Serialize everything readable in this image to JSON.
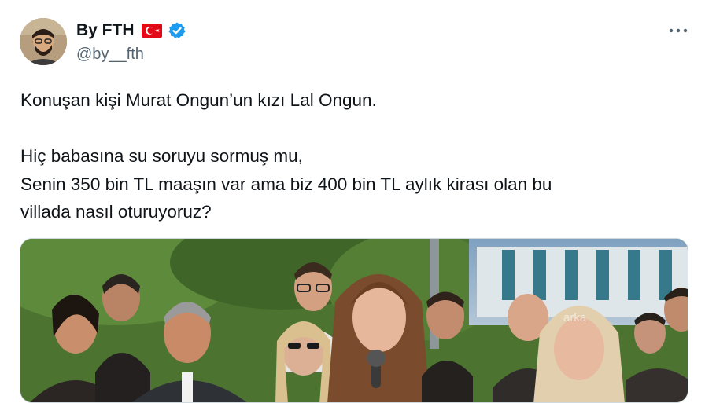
{
  "author": {
    "display_name": "By FTH",
    "handle": "@by__fth",
    "flag_icon": "turkey-flag-icon",
    "verified_icon": "verified-badge-icon"
  },
  "tweet": {
    "text": "Konuşan kişi Murat Ongun’un kızı Lal Ongun.\n\nHiç babasına su soruyu sormuş mu,\nSenin 350 bin TL maaşın var ama biz 400 bin TL aylık kirası olan bu\nvillada nasıl oturuyoruz?"
  },
  "media": {
    "watermark": "arka"
  },
  "colors": {
    "verified": "#1d9bf0",
    "flag_red": "#e30a17",
    "handle_gray": "#536471"
  }
}
